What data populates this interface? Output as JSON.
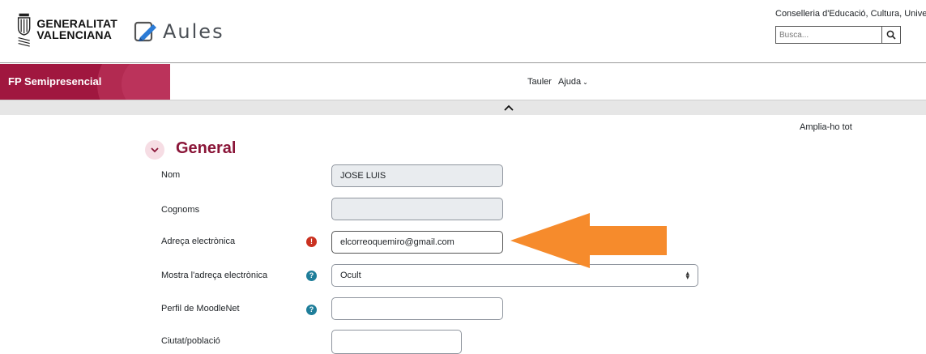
{
  "header": {
    "gva_logo_line1": "GENERALITAT",
    "gva_logo_line2": "VALENCIANA",
    "app_name": "Aules",
    "conselleria": "Conselleria d'Educació, Cultura, Universitats i Ocupació",
    "search": {
      "placeholder": "Busca...",
      "icon": "search-icon"
    }
  },
  "navbar": {
    "brand": "FP Semipresencial",
    "links": [
      "Tauler",
      "Ajuda"
    ],
    "help_dropdown_icon": "chevron-down-icon"
  },
  "collapse_bar": {
    "icon": "chevron-up-icon"
  },
  "content": {
    "expand_all": "Amplia-ho tot",
    "section": {
      "title": "General",
      "toggle_icon": "chevron-down-icon"
    },
    "fields": {
      "nom": {
        "label": "Nom",
        "value": "JOSE LUIS"
      },
      "cognoms": {
        "label": "Cognoms",
        "value": ""
      },
      "email": {
        "label": "Adreça electrònica",
        "value": "elcorreoquemiro@gmail.com",
        "icon": "required-icon"
      },
      "show_email": {
        "label": "Mostra l'adreça electrònica",
        "value": "Ocult",
        "icon": "help-icon"
      },
      "moodlenet": {
        "label": "Perfil de MoodleNet",
        "value": "",
        "icon": "help-icon"
      },
      "city": {
        "label": "Ciutat/població",
        "value": ""
      }
    }
  },
  "colors": {
    "brand": "#a0173f",
    "section_title": "#8a1538",
    "annotation_arrow": "#f68b2c",
    "required_icon": "#ca3120",
    "help_icon": "#1f7e9a"
  }
}
